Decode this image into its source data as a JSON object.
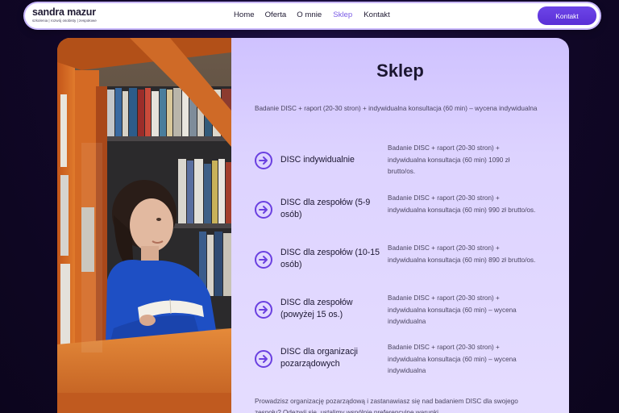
{
  "header": {
    "logo_name": "sandra mazur",
    "logo_tagline": "szkolenia | rozwój osobisty | zespołowe",
    "nav": [
      {
        "label": "Home",
        "active": false
      },
      {
        "label": "Oferta",
        "active": false
      },
      {
        "label": "O mnie",
        "active": false
      },
      {
        "label": "Sklep",
        "active": true
      },
      {
        "label": "Kontakt",
        "active": false
      }
    ],
    "contact_button": "Kontakt"
  },
  "main": {
    "title": "Sklep",
    "intro": "Badanie DISC + raport (20-30 stron) + indywidualna konsultacja (60 min) – wycena indywidualna",
    "products": [
      {
        "name": "DISC indywidualnie",
        "description": "Badanie DISC + raport  (20-30 stron) + indywidualna konsultacja (60 min) 1090 zł brutto/os."
      },
      {
        "name": "DISC dla zespołów (5-9 osób)",
        "description": "Badanie DISC + raport (20-30 stron) + indywidualna konsultacja (60 min) 990 zł brutto/os."
      },
      {
        "name": "DISC dla zespołów (10-15 osób)",
        "description": "Badanie DISC + raport (20-30 stron) + indywidualna konsultacja (60 min) 890 zł brutto/os."
      },
      {
        "name": "DISC dla zespołów (powyżej 15 os.)",
        "description": "Badanie DISC + raport (20-30 stron) + indywidualna konsultacja (60 min) – wycena indywidualna"
      },
      {
        "name": "DISC dla organizacji pozarządowych",
        "description": "Badanie DISC + raport (20-30 stron) + indywidualna konsultacja (60 min) – wycena indywidualna"
      }
    ],
    "outro": "Prowadzisz organizację pozarządową i zastanawiasz się nad badaniem DISC dla swojego zespołu? Odezwij się, ustalimy wspólnie preferencyjne warunki."
  },
  "colors": {
    "accent": "#6a40e0",
    "active_nav": "#7b5ce6",
    "panel_bg": "#ddd3ff",
    "page_bg": "#12082c"
  },
  "icons": {
    "product_arrow": "arrow-right-circle-icon"
  }
}
